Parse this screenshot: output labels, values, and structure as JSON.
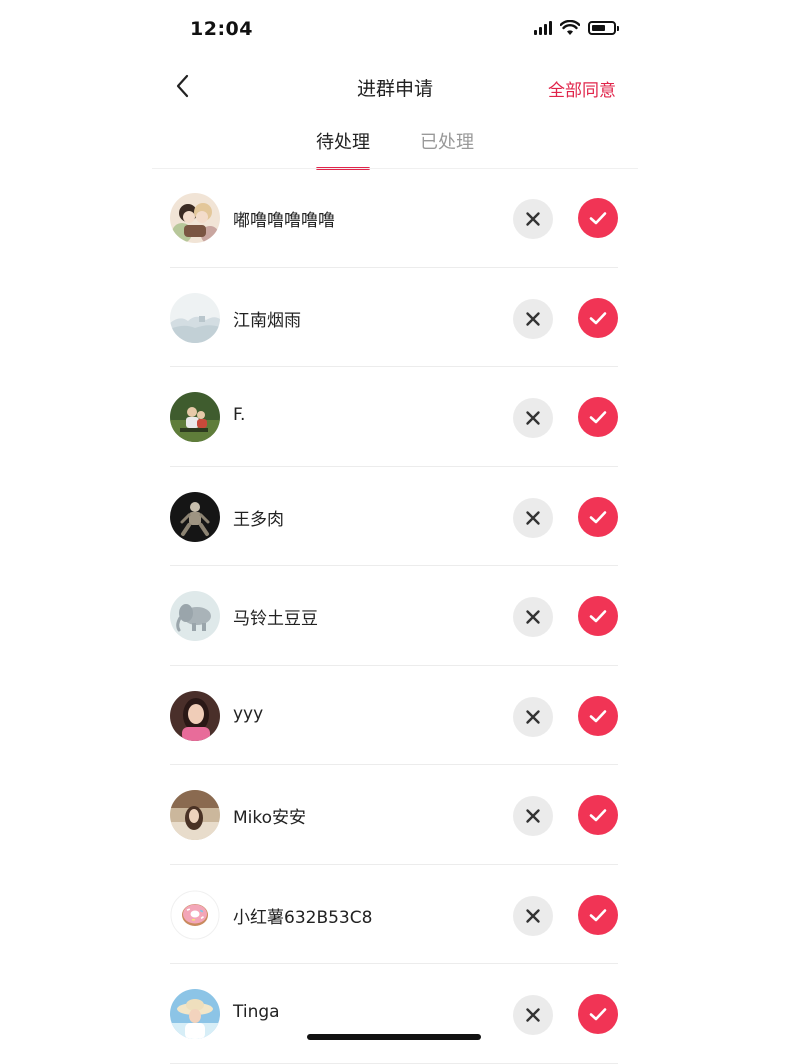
{
  "status_bar": {
    "time": "12:04"
  },
  "nav": {
    "title": "进群申请",
    "accept_all": "全部同意"
  },
  "tabs": [
    {
      "label": "待处理",
      "active": true
    },
    {
      "label": "已处理",
      "active": false
    }
  ],
  "colors": {
    "accent": "#e0244a",
    "approve": "#f13455",
    "reject_bg": "#ebebeb"
  },
  "requests": [
    {
      "name": "嘟噜噜噜噜噜",
      "avatar": "anime-couple"
    },
    {
      "name": "江南烟雨",
      "avatar": "misty-landscape"
    },
    {
      "name": "F.",
      "avatar": "people-on-grass"
    },
    {
      "name": "王多肉",
      "avatar": "dark-figure"
    },
    {
      "name": "马铃土豆豆",
      "avatar": "flying-elephant"
    },
    {
      "name": "yyy",
      "avatar": "girl-pink"
    },
    {
      "name": "Miko安安",
      "avatar": "girl-room"
    },
    {
      "name": "小红薯632B53C8",
      "avatar": "donut"
    },
    {
      "name": "Tinga",
      "avatar": "girl-sunhat"
    }
  ]
}
